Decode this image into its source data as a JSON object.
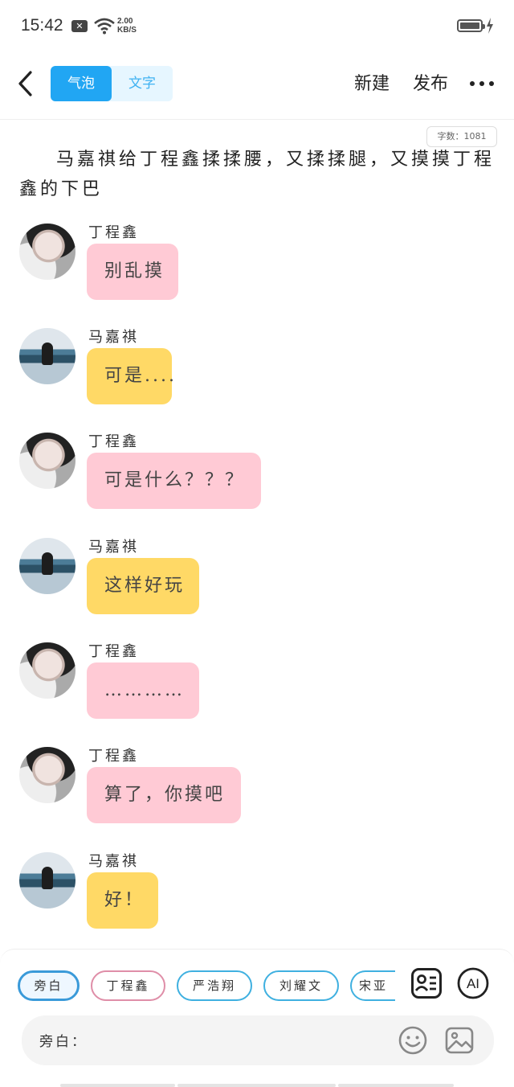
{
  "status_bar": {
    "time": "15:42",
    "speed_value": "2.00",
    "speed_unit": "KB/S"
  },
  "header": {
    "tabs": [
      {
        "label": "气泡",
        "active": true
      },
      {
        "label": "文字",
        "active": false
      }
    ],
    "new_label": "新建",
    "publish_label": "发布"
  },
  "word_count": "字数：1081",
  "narration": "马嘉祺给丁程鑫揉揉腰，又揉揉腿，又摸摸丁程鑫的下巴",
  "messages": [
    {
      "speaker": "丁程鑫",
      "text": "别乱摸",
      "color": "pink"
    },
    {
      "speaker": "马嘉祺",
      "text": "可是....",
      "color": "yellow"
    },
    {
      "speaker": "丁程鑫",
      "text": "可是什么？？？",
      "color": "pink"
    },
    {
      "speaker": "马嘉祺",
      "text": "这样好玩",
      "color": "yellow"
    },
    {
      "speaker": "丁程鑫",
      "text": "…………",
      "color": "pink"
    },
    {
      "speaker": "丁程鑫",
      "text": "算了，你摸吧",
      "color": "pink"
    },
    {
      "speaker": "马嘉祺",
      "text": "好！",
      "color": "yellow"
    }
  ],
  "colors": {
    "accent": "#21a6f3",
    "pink_bubble": "#ffcad5",
    "yellow_bubble": "#ffd966",
    "chip_pink_border": "#df8ea8",
    "chip_blue_border": "#3fb0e0"
  },
  "role_chips": [
    "旁白",
    "丁程鑫",
    "严浩翔",
    "刘耀文",
    "宋亚"
  ],
  "ai_label": "AI",
  "input": {
    "label": "旁白："
  },
  "icons": [
    "back-chevron-icon",
    "more-dots-icon",
    "contact-card-icon",
    "ai-icon",
    "emoji-icon",
    "image-icon",
    "wifi-icon",
    "battery-icon"
  ]
}
